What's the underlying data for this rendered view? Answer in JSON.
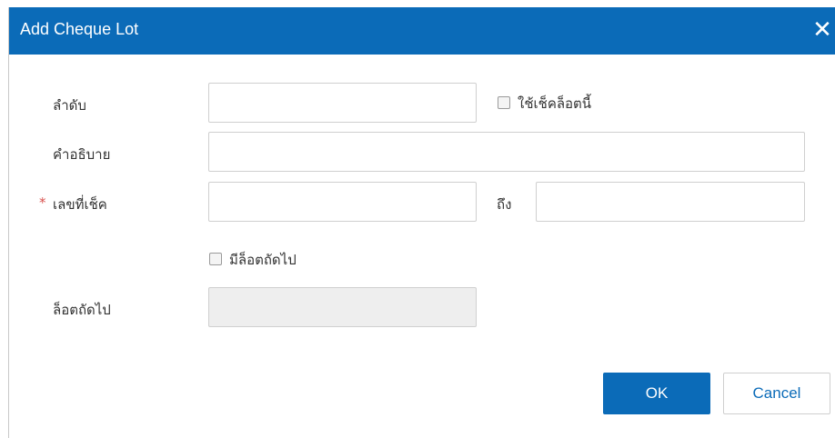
{
  "dialog": {
    "title": "Add Cheque Lot",
    "close_icon": "close-icon"
  },
  "form": {
    "sequence_label": "ลำดับ",
    "sequence_value": "",
    "use_this_lot_label": "ใช้เช็คล็อตนี้",
    "use_this_lot_checked": false,
    "description_label": "คำอธิบาย",
    "description_value": "",
    "required_marker": "*",
    "cheque_no_label": "เลขที่เช็ค",
    "cheque_no_from": "",
    "to_label": "ถึง",
    "cheque_no_to": "",
    "has_next_lot_label": "มีล็อตถัดไป",
    "has_next_lot_checked": false,
    "next_lot_label": "ล็อตถัดไป",
    "next_lot_value": ""
  },
  "buttons": {
    "ok_label": "OK",
    "cancel_label": "Cancel"
  },
  "colors": {
    "primary": "#0b6bb8",
    "required": "#d9534f"
  }
}
